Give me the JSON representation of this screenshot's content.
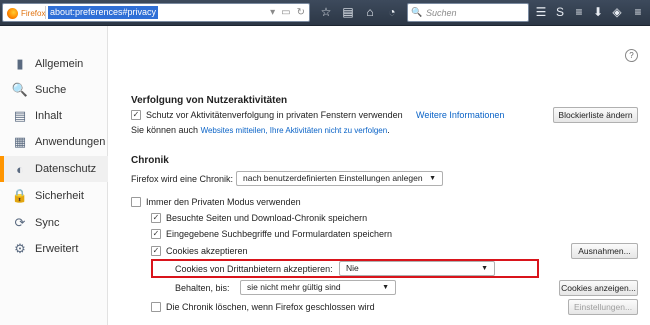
{
  "browser": {
    "brand_label": "Firefox",
    "url": "about:preferences#privacy",
    "search_placeholder": "Suchen"
  },
  "sidebar": {
    "items": [
      {
        "label": "Allgemein",
        "icon": "switch-icon"
      },
      {
        "label": "Suche",
        "icon": "search-icon"
      },
      {
        "label": "Inhalt",
        "icon": "document-icon"
      },
      {
        "label": "Anwendungen",
        "icon": "apps-icon"
      },
      {
        "label": "Datenschutz",
        "icon": "mask-icon",
        "active": true
      },
      {
        "label": "Sicherheit",
        "icon": "lock-icon"
      },
      {
        "label": "Sync",
        "icon": "sync-icon"
      },
      {
        "label": "Erweitert",
        "icon": "gear-icon"
      }
    ]
  },
  "tracking": {
    "heading": "Verfolgung von Nutzeraktivitäten",
    "private_protection_label": "Schutz vor Aktivitätenverfolgung in privaten Fenstern verwenden",
    "more_info_link": "Weitere Informationen",
    "blocklist_button": "Blockierliste ändern",
    "dnt_prefix": "Sie können auch",
    "dnt_link": "Websites mitteilen, Ihre Aktivitäten nicht zu verfolgen",
    "dnt_suffix": "."
  },
  "history": {
    "heading": "Chronik",
    "mode_label": "Firefox wird eine Chronik:",
    "mode_value": "nach benutzerdefinierten Einstellungen anlegen",
    "always_private_label": "Immer den Privaten Modus verwenden",
    "visited_label": "Besuchte Seiten und Download-Chronik speichern",
    "forms_label": "Eingegebene Suchbegriffe und Formulardaten speichern",
    "cookies_label": "Cookies akzeptieren",
    "exceptions_button": "Ausnahmen...",
    "third_party_label": "Cookies von Drittanbietern akzeptieren:",
    "third_party_value": "Nie",
    "keep_label": "Behalten, bis:",
    "keep_value": "sie nicht mehr gültig sind",
    "show_cookies_button": "Cookies anzeigen...",
    "clear_on_close_label": "Die Chronik löschen, wenn Firefox geschlossen wird",
    "settings_button": "Einstellungen..."
  },
  "colors": {
    "accent": "#ff9500",
    "link": "#0a63c7",
    "highlight_box": "#d9141b"
  }
}
